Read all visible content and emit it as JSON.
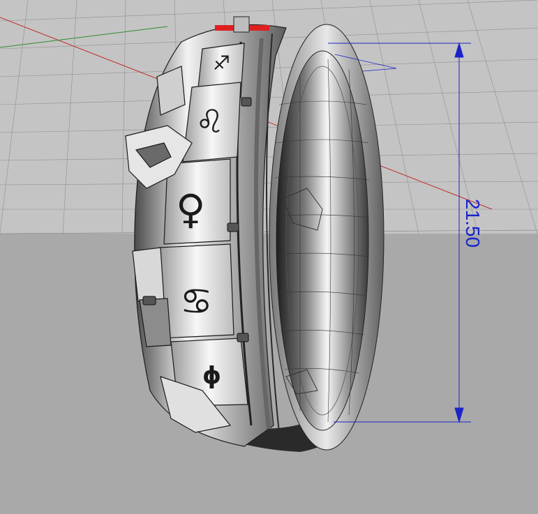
{
  "viewport": {
    "projection": "perspective",
    "background_color": "#a9a9a9",
    "grid_color": "#8f8f8f",
    "x_axis_color": "#c0302c",
    "y_axis_color": "#2f8a2f"
  },
  "model": {
    "object": "zodiac-ring",
    "selection_highlight_color": "#e02020",
    "symbols": [
      "♐",
      "♌",
      "♀",
      "♋",
      "ϕ"
    ]
  },
  "dimension": {
    "value": "21.50",
    "color": "#1a24c8"
  }
}
